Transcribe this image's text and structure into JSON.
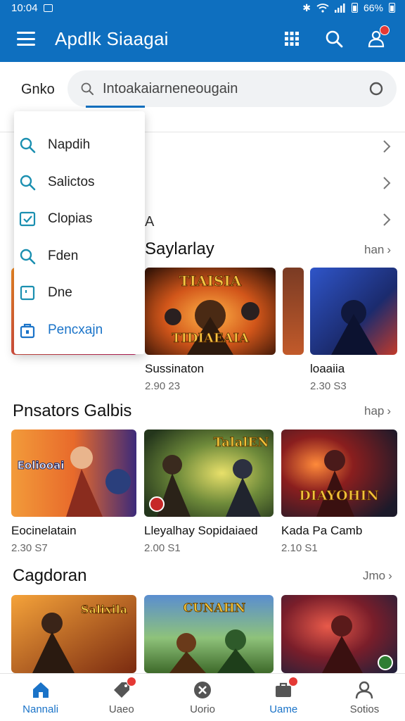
{
  "status_bar": {
    "time": "10:04",
    "battery": "66%"
  },
  "app_bar": {
    "title": "Apdlk Siaagai"
  },
  "search": {
    "filter_label": "Gnko",
    "value": "Intoakaiarneneougain"
  },
  "dropdown": {
    "items": [
      {
        "label": "Napdih",
        "icon": "search-icon"
      },
      {
        "label": "Salictos",
        "icon": "search-icon"
      },
      {
        "label": "Clopias",
        "icon": "checkbox-icon"
      },
      {
        "label": "Fden",
        "icon": "search-icon"
      },
      {
        "label": "Dne",
        "icon": "square-icon"
      },
      {
        "label": "Pencxajn",
        "icon": "bag-icon"
      }
    ]
  },
  "categories": [
    {
      "label": ""
    },
    {
      "label": ""
    },
    {
      "label": "A"
    }
  ],
  "sections": [
    {
      "title": "Saylarlay",
      "more": "han",
      "cards": [
        {
          "name": "Sussinaton",
          "meta": "2.90 23"
        },
        {
          "name": "",
          "meta": ""
        },
        {
          "name": "loaaiia",
          "meta": "2.30 S3"
        }
      ]
    },
    {
      "title": "Pnsators Galbis",
      "more": "hap",
      "cards": [
        {
          "name": "Eocinelatain",
          "meta": "2.30 S7",
          "thumb_text": "Eoliooai"
        },
        {
          "name": "Lleyalhay Sopidaiaed",
          "meta": "2.00 S1",
          "thumb_text": "TalalEN"
        },
        {
          "name": "Kada Pa Camb",
          "meta": "2.10 S1",
          "thumb_text": "DIAYOHIN"
        }
      ]
    },
    {
      "title": "Cagdoran",
      "more": "Jmo",
      "cards": [
        {
          "name": "",
          "meta": "",
          "thumb_text": "Salixila"
        },
        {
          "name": "",
          "meta": "",
          "thumb_text": "CUNAHN"
        },
        {
          "name": "",
          "meta": ""
        }
      ]
    }
  ],
  "featured_thumbs": {
    "card1": "TIAISIA",
    "card1_sub": "TIDIAEAIA"
  },
  "bottom_nav": [
    {
      "label": "Nannali",
      "icon": "home-icon",
      "active": true
    },
    {
      "label": "Uaeo",
      "icon": "tag-icon",
      "active": false
    },
    {
      "label": "Uorio",
      "icon": "close-circle-icon",
      "active": false
    },
    {
      "label": "Uame",
      "icon": "briefcase-icon",
      "active": false
    },
    {
      "label": "Sotios",
      "icon": "person-icon",
      "active": false
    }
  ],
  "colors": {
    "primary": "#0e6fbf",
    "accent": "#1a73c8",
    "badge": "#e53935"
  }
}
